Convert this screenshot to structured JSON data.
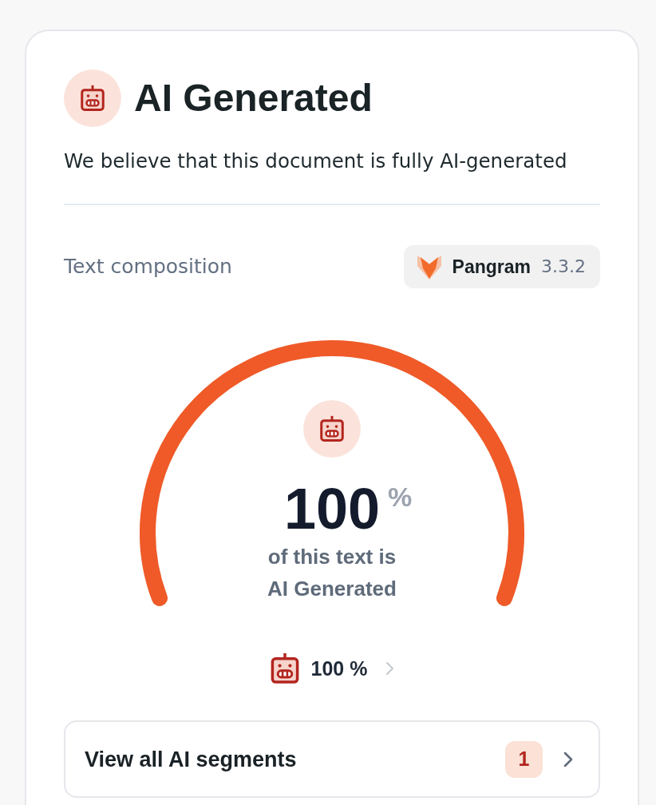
{
  "header": {
    "title": "AI Generated",
    "description": "We believe that this document is fully AI-generated"
  },
  "composition": {
    "label": "Text composition",
    "model_badge": {
      "name": "Pangram",
      "version": "3.3.2"
    }
  },
  "gauge": {
    "level": 1,
    "value": "100",
    "unit": "%",
    "caption_lines": [
      "of this text is",
      "AI Generated"
    ]
  },
  "breakdown": {
    "value": "100 %"
  },
  "segments_button": {
    "label": "View all AI segments",
    "count": "1"
  }
}
